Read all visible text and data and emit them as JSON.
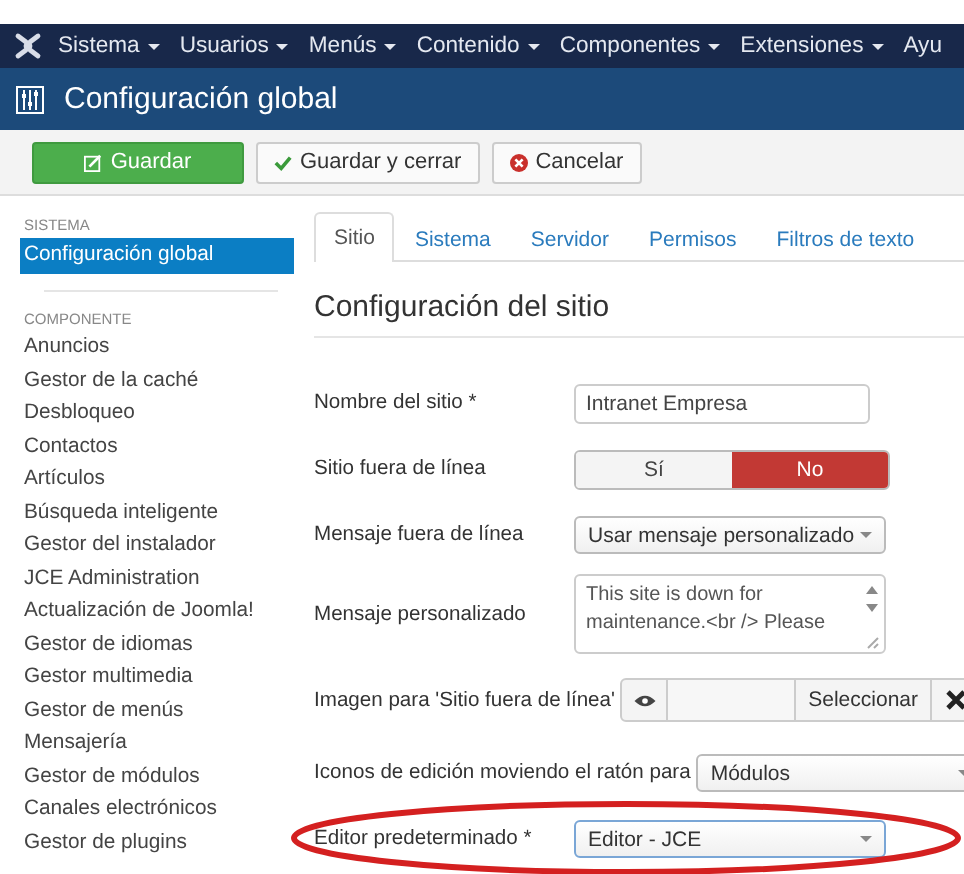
{
  "navbar": {
    "menus": [
      {
        "label": "Sistema",
        "caret": true
      },
      {
        "label": "Usuarios",
        "caret": true
      },
      {
        "label": "Menús",
        "caret": true
      },
      {
        "label": "Contenido",
        "caret": true
      },
      {
        "label": "Componentes",
        "caret": true
      },
      {
        "label": "Extensiones",
        "caret": true
      },
      {
        "label": "Ayu",
        "caret": false
      }
    ]
  },
  "header": {
    "title": "Configuración global"
  },
  "toolbar": {
    "buttons": [
      {
        "label": "Guardar",
        "kind": "save"
      },
      {
        "label": "Guardar y cerrar",
        "kind": "check"
      },
      {
        "label": "Cancelar",
        "kind": "cancel"
      }
    ]
  },
  "sidebar": {
    "sections": [
      {
        "heading": "SISTEMA",
        "items": [
          {
            "label": "Configuración global",
            "selected": true
          }
        ]
      },
      {
        "heading": "COMPONENTE",
        "items": [
          {
            "label": "Anuncios",
            "selected": false
          },
          {
            "label": "Gestor de la caché",
            "selected": false
          },
          {
            "label": "Desbloqueo",
            "selected": false
          },
          {
            "label": "Contactos",
            "selected": false
          },
          {
            "label": "Artículos",
            "selected": false
          },
          {
            "label": "Búsqueda inteligente",
            "selected": false
          },
          {
            "label": "Gestor del instalador",
            "selected": false
          },
          {
            "label": "JCE Administration",
            "selected": false
          },
          {
            "label": "Actualización de Joomla!",
            "selected": false
          },
          {
            "label": "Gestor de idiomas",
            "selected": false
          },
          {
            "label": "Gestor multimedia",
            "selected": false
          },
          {
            "label": "Gestor de menús",
            "selected": false
          },
          {
            "label": "Mensajería",
            "selected": false
          },
          {
            "label": "Gestor de módulos",
            "selected": false
          },
          {
            "label": "Canales electrónicos",
            "selected": false
          },
          {
            "label": "Gestor de plugins",
            "selected": false
          }
        ]
      }
    ]
  },
  "tabs": [
    {
      "label": "Sitio",
      "selected": true
    },
    {
      "label": "Sistema",
      "selected": false
    },
    {
      "label": "Servidor",
      "selected": false
    },
    {
      "label": "Permisos",
      "selected": false
    },
    {
      "label": "Filtros de texto",
      "selected": false
    }
  ],
  "section_title": "Configuración del sitio",
  "fields": [
    {
      "kind": "text",
      "label": "Nombre del sitio *",
      "value": "Intranet Empresa",
      "highlighted": false
    },
    {
      "kind": "toggle",
      "label": "Sitio fuera de línea",
      "options": [
        {
          "label": "Sí",
          "selected": false
        },
        {
          "label": "No",
          "selected": true
        }
      ],
      "highlighted": false
    },
    {
      "kind": "select",
      "label": "Mensaje fuera de línea",
      "value": "Usar mensaje personalizado",
      "highlighted": false
    },
    {
      "kind": "textarea",
      "label": "Mensaje personalizado",
      "value": "This site is down for maintenance.<br /> Please",
      "highlighted": false
    },
    {
      "kind": "media",
      "label": "Imagen para 'Sitio fuera de línea'",
      "button": "Seleccionar",
      "highlighted": false
    },
    {
      "kind": "wideselect",
      "label": "Iconos de edición moviendo el ratón para",
      "value": "Módulos",
      "highlighted": false
    },
    {
      "kind": "select",
      "label": "Editor predeterminado *",
      "value": "Editor - JCE",
      "highlighted": true
    }
  ]
}
